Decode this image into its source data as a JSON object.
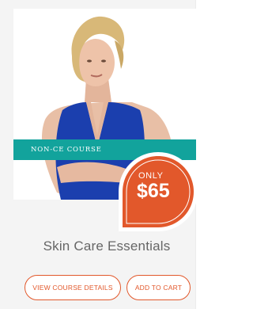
{
  "course": {
    "type_label": "NON-CE COURSE",
    "price_prefix": "ONLY",
    "price": "$65",
    "title": "Skin Care Essentials"
  },
  "actions": {
    "details_label": "VIEW COURSE DETAILS",
    "cart_label": "ADD TO CART"
  },
  "colors": {
    "accent_orange": "#e2582b",
    "banner_teal": "#12a39c",
    "dress_blue": "#1b3fae"
  }
}
